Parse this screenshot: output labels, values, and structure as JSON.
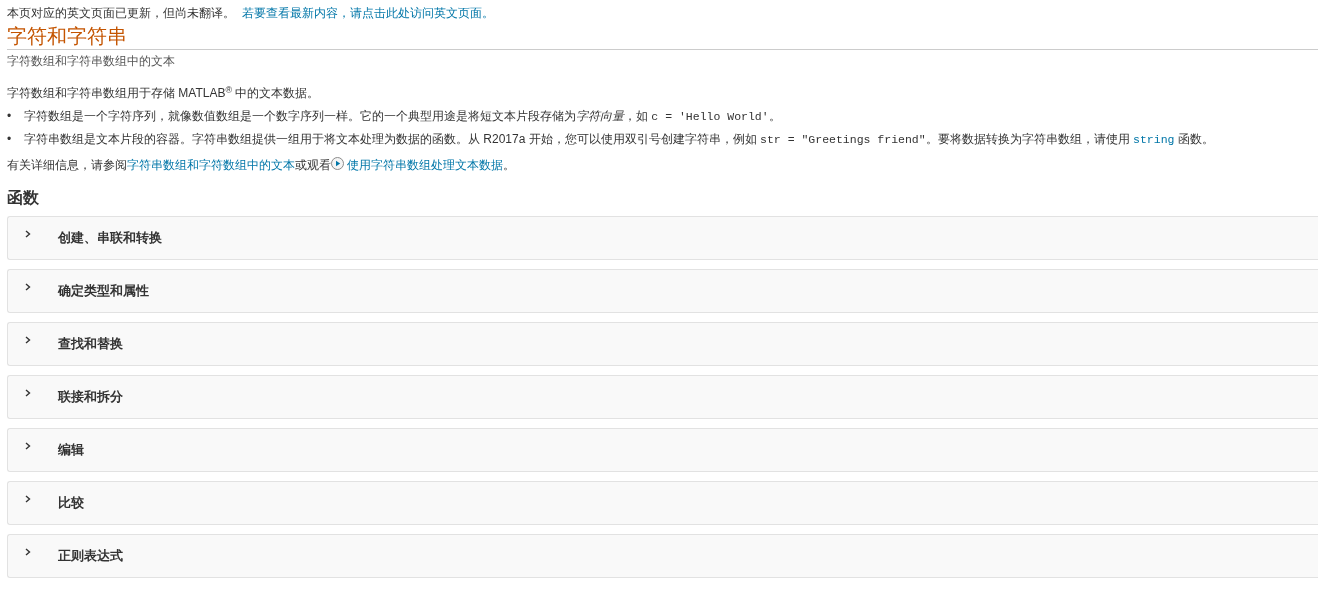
{
  "notice": {
    "text": "本页对应的英文页面已更新，但尚未翻译。",
    "link": "若要查看最新内容，请点击此处访问英文页面。"
  },
  "title": "字符和字符串",
  "subtitle": "字符数组和字符串数组中的文本",
  "intro": "字符数组和字符串数组用于存储 MATLAB$^{®}$ 中的文本数据。",
  "bullets": [
    {
      "marker": "•",
      "segments": [
        {
          "kind": "text",
          "text": "字符数组是一个字符序列，就像数值数组是一个数字序列一样。它的一个典型用途是将短文本片段存储为"
        },
        {
          "kind": "italic",
          "text": "字符向量"
        },
        {
          "kind": "text",
          "text": "，如 "
        },
        {
          "kind": "code",
          "text": "c = 'Hello World'"
        },
        {
          "kind": "text",
          "text": "。"
        }
      ]
    },
    {
      "marker": "•",
      "segments": [
        {
          "kind": "text",
          "text": "字符串数组是文本片段的容器。字符串数组提供一组用于将文本处理为数据的函数。从 R2017a 开始，您可以使用双引号创建字符串，例如 "
        },
        {
          "kind": "code",
          "text": "str = \"Greetings friend\""
        },
        {
          "kind": "text",
          "text": "。要将数据转换为字符串数组，请使用 "
        },
        {
          "kind": "codelink",
          "text": "string"
        },
        {
          "kind": "text",
          "text": " 函数。"
        }
      ]
    }
  ],
  "more_info": [
    {
      "kind": "text",
      "text": "有关详细信息，请参阅"
    },
    {
      "kind": "link",
      "text": "字符串数组和字符数组中的文本"
    },
    {
      "kind": "text",
      "text": "或观看"
    },
    {
      "kind": "video",
      "text": " 使用字符串数组处理文本数据"
    },
    {
      "kind": "text",
      "text": "。"
    }
  ],
  "functions_heading": "函数",
  "sections": [
    {
      "label": "创建、串联和转换",
      "expanded": false
    },
    {
      "label": "确定类型和属性",
      "expanded": false
    },
    {
      "label": "查找和替换",
      "expanded": false
    },
    {
      "label": "联接和拆分",
      "expanded": false
    },
    {
      "label": "编辑",
      "expanded": false
    },
    {
      "label": "比较",
      "expanded": false
    },
    {
      "label": "正则表达式",
      "expanded": false
    }
  ]
}
